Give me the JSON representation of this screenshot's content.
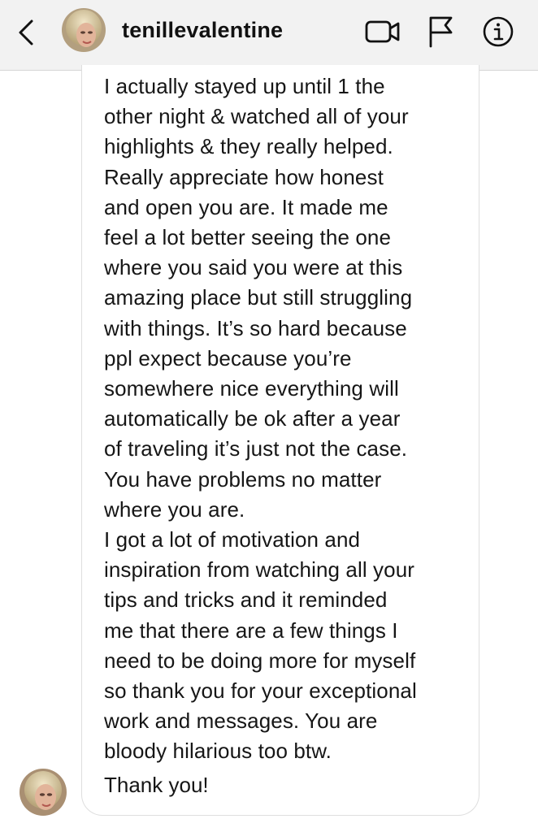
{
  "header": {
    "username": "tenillevalentine",
    "icons": {
      "back": "chevron-left-icon",
      "video": "video-camera-icon",
      "flag": "flag-icon",
      "info": "info-icon"
    }
  },
  "message": {
    "text": "I actually stayed up until 1 the\nother night & watched all of your\nhighlights & they really helped.\nReally appreciate how honest\nand open you are. It made me\nfeel a lot better seeing the one\nwhere you said you were at this\namazing place but still struggling\nwith things. It’s so hard because\nppl expect because you’re\nsomewhere nice everything will\nautomatically be ok after a year\nof traveling it’s just not the case.\nYou have problems no matter\nwhere you are.\nI got a lot of motivation and\ninspiration from watching all your\ntips and tricks and it reminded\nme that there are a few things I\nneed to be doing more for myself\nso thank you for your exceptional\nwork and messages. You are\nbloody hilarious too btw.",
    "last_line": "Thank you!"
  },
  "colors": {
    "header_bg": "#f2f2f2",
    "bubble_border": "#dedede",
    "text": "#161616"
  }
}
